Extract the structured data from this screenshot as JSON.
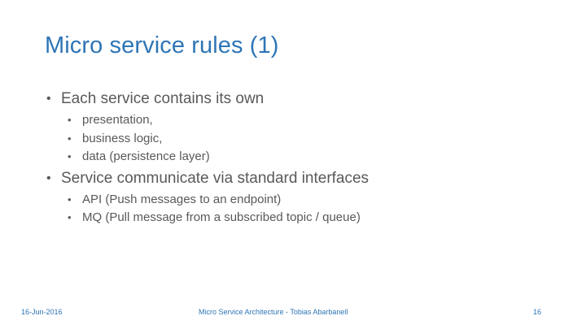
{
  "slide": {
    "title": "Micro service rules (1)",
    "bullets": [
      {
        "text": "Each service contains its own",
        "children": [
          "presentation,",
          "business logic,",
          "data (persistence layer)"
        ]
      },
      {
        "text": "Service communicate via standard interfaces",
        "children": [
          "API (Push messages to an endpoint)",
          "MQ (Pull message from a subscribed topic / queue)"
        ]
      }
    ]
  },
  "footer": {
    "date": "16-Jun-2016",
    "center": "Micro Service Architecture - Tobias Abarbanell",
    "page": "16"
  },
  "colors": {
    "title": "#2E75B6",
    "body_text": "#595959",
    "footer": "#2E75B6",
    "background": "#ffffff"
  },
  "icons": {
    "bullet": "•"
  }
}
